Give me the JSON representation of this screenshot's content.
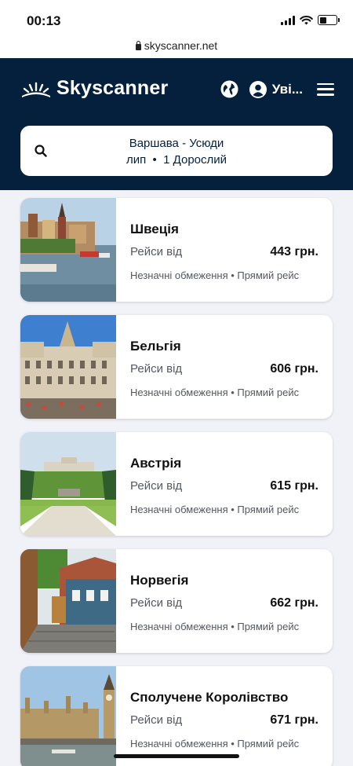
{
  "status_bar": {
    "time": "00:13"
  },
  "browser": {
    "url": "skyscanner.net"
  },
  "header": {
    "logo_text": "Skyscanner",
    "login_label": "Уві..."
  },
  "search": {
    "route": "Варшава - Усюди",
    "summary": "лип  •  1 Дорослий"
  },
  "destinations": [
    {
      "country": "Швеція",
      "from_label": "Рейси від",
      "price": "443 грн.",
      "details": "Незначні обмеження • Прямий рейс",
      "image": "stockholm-old-town-photo"
    },
    {
      "country": "Бельгія",
      "from_label": "Рейси від",
      "price": "606 грн.",
      "details": "Незначні обмеження • Прямий рейс",
      "image": "brussels-grand-place-photo"
    },
    {
      "country": "Австрія",
      "from_label": "Рейси від",
      "price": "615 грн.",
      "details": "Незначні обмеження • Прямий рейс",
      "image": "vienna-schonbrunn-gardens-photo"
    },
    {
      "country": "Норвегія",
      "from_label": "Рейси від",
      "price": "662 грн.",
      "details": "Незначні обмеження • Прямий рейс",
      "image": "bergen-wooden-houses-photo"
    },
    {
      "country": "Сполучене Королівство",
      "from_label": "Рейси від",
      "price": "671 грн.",
      "details": "Незначні обмеження • Прямий рейс",
      "image": "london-big-ben-photo"
    }
  ],
  "colors": {
    "header_bg": "#05203c",
    "page_bg": "#f1f2f8",
    "card_bg": "#ffffff",
    "muted_text": "#545860"
  }
}
